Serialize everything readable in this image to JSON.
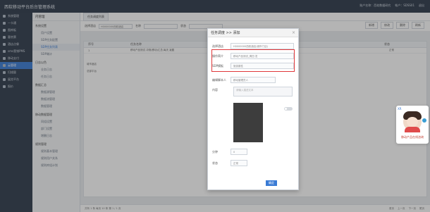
{
  "app": {
    "title": "西软移动平台后台管理系统"
  },
  "topbar": {
    "items": [
      "账户名称：西软数据研究",
      "帐户：SDSS01",
      "退出"
    ]
  },
  "sidebar": {
    "items": [
      {
        "label": "系统管理",
        "active": false
      },
      {
        "label": "一卡通",
        "active": false
      },
      {
        "label": "图库板",
        "active": false
      },
      {
        "label": "客房票",
        "active": false
      },
      {
        "label": "酒店点餐",
        "active": false
      },
      {
        "label": "sms营销PMS",
        "active": false
      },
      {
        "label": "移动支付",
        "active": false
      },
      {
        "label": "云管理",
        "active": true
      },
      {
        "label": "扫描量",
        "active": false
      },
      {
        "label": "展览平台",
        "active": false
      },
      {
        "label": "报价",
        "active": false
      }
    ]
  },
  "subnav": {
    "header": "内管理",
    "groups": [
      {
        "title": "系统设置",
        "links": [
          {
            "label": "用户设置",
            "active": false
          },
          {
            "label": "SDP任务配置",
            "active": false
          },
          {
            "label": "SDP任务列表",
            "active": true
          },
          {
            "label": "SDP端计",
            "active": false
          }
        ]
      },
      {
        "title": "日志以色",
        "links": [
          {
            "label": "业务日志",
            "active": false
          },
          {
            "label": "任务日志",
            "active": false
          }
        ]
      },
      {
        "title": "数据汇总",
        "links": [
          {
            "label": "数据源管理",
            "active": false
          },
          {
            "label": "数据流管理",
            "active": false
          },
          {
            "label": "数据管理",
            "active": false
          }
        ]
      },
      {
        "title": "移动数据管理",
        "links": [
          {
            "label": "同组设置",
            "active": false
          },
          {
            "label": "部门设置",
            "active": false
          },
          {
            "label": "增删日志",
            "active": false
          }
        ]
      },
      {
        "title": "规则管理",
        "links": [
          {
            "label": "规则基本管理",
            "active": false
          },
          {
            "label": "规则用户关系",
            "active": false
          },
          {
            "label": "规则库组计划",
            "active": false
          }
        ]
      }
    ]
  },
  "main": {
    "tab": "任务调度列表",
    "filters": {
      "label1": "选择酒店",
      "value1": "H0000000西软酒店",
      "label2": "名称",
      "label3": "状态"
    },
    "buttons": [
      "新增",
      "修改",
      "删除",
      "刷新"
    ],
    "columns": [
      "序号",
      "任务名称",
      "执行状态",
      "",
      "状态"
    ],
    "tree": [
      "城市酒店",
      "总部平台"
    ],
    "rows": [
      {
        "index": "1",
        "name": "移动产品测试 冲测(移动)汇总,每天 凌晨",
        "status": "正常"
      }
    ],
    "footer": {
      "left": "共有 1 条  每页 10 条  第 1 / 1 页",
      "right": [
        "首页",
        "上一页",
        "下一页",
        "尾页"
      ]
    }
  },
  "modal": {
    "title": "任务调度 >> 添加",
    "close": "×",
    "fields": [
      {
        "label": "选择酒店",
        "value": "H0000000西软酒店(城市门店)"
      },
      {
        "label": "操作简介",
        "value": "移动产品测试_周四 发"
      },
      {
        "label": "SDP模板",
        "value": "旅游属性"
      },
      {
        "label": "编辑脚本人",
        "value": "移动管理员人"
      },
      {
        "label": "内容",
        "value": "请输入描述文本"
      },
      {
        "label": "分钟",
        "value": "0"
      },
      {
        "label": "状态",
        "value": "正常"
      }
    ],
    "submit": "确定"
  },
  "widget": {
    "badge": "XR",
    "label": "移动产品在线咨询"
  }
}
